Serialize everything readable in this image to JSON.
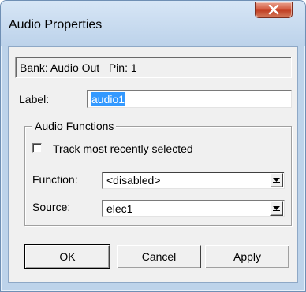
{
  "window": {
    "title": "Audio Properties",
    "close_icon": "close-icon"
  },
  "info": {
    "text": "Bank: Audio Out   Pin: 1"
  },
  "label_field": {
    "caption": "Label:",
    "value": "audio1"
  },
  "audio_functions": {
    "caption": "Audio Functions",
    "track_recent": {
      "label": "Track most recently selected",
      "checked": false
    },
    "function": {
      "caption": "Function:",
      "value": "<disabled>"
    },
    "source": {
      "caption": "Source:",
      "value": "elec1"
    }
  },
  "buttons": {
    "ok": "OK",
    "cancel": "Cancel",
    "apply": "Apply"
  },
  "colors": {
    "frame": "#bdd3ea",
    "close_button": "#c94a2e",
    "selection": "#3399ff"
  }
}
